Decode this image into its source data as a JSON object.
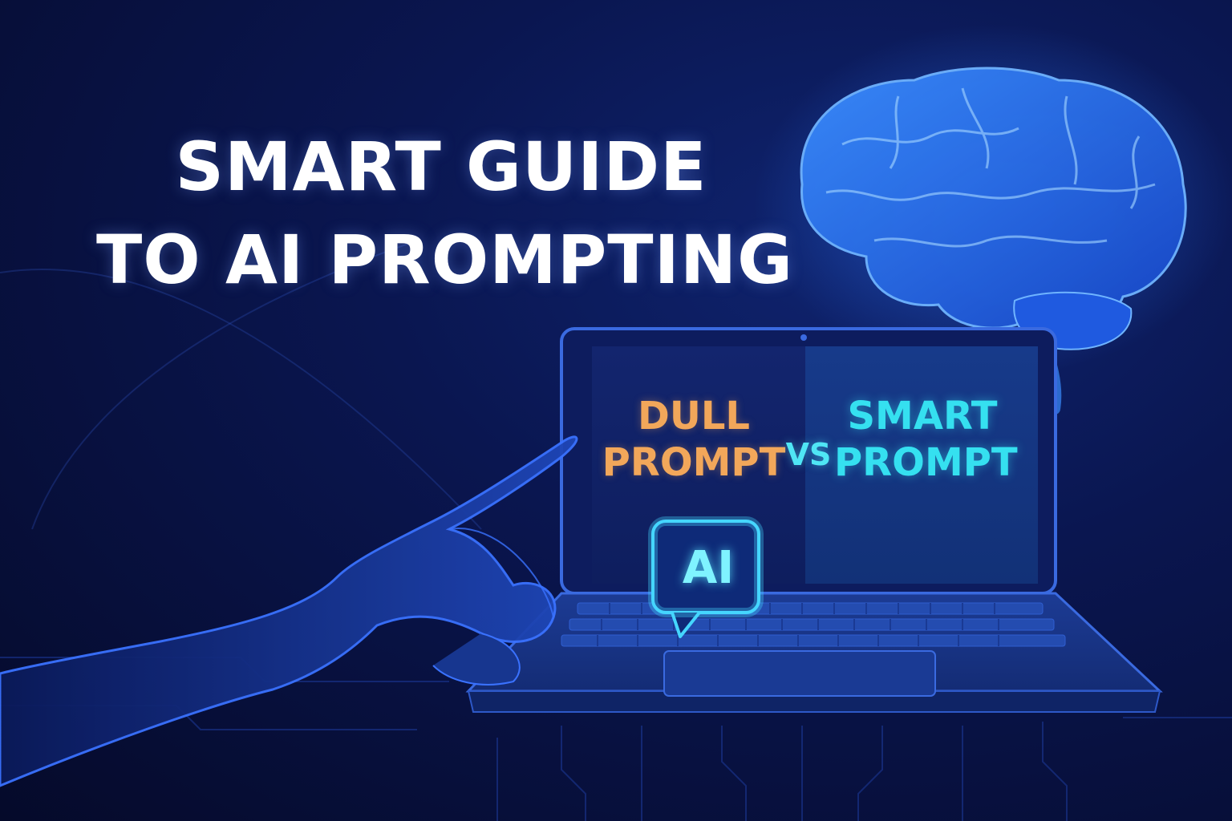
{
  "headline": {
    "line1": "SMART GUIDE",
    "line2": "TO AI PROMPTING"
  },
  "screen": {
    "left_line1": "DULL",
    "left_line2": "PROMPT",
    "vs": "VS",
    "right_line1": "SMART",
    "right_line2": "PROMPT"
  },
  "badge": {
    "label": "AI"
  },
  "colors": {
    "background": "#0a1650",
    "dull": "#f2a75a",
    "smart": "#35e0f0",
    "glow": "#3a8dff",
    "headline": "#ffffff"
  },
  "icons": [
    "brain-icon",
    "laptop-icon",
    "hand-icon",
    "chat-bubble-icon"
  ]
}
